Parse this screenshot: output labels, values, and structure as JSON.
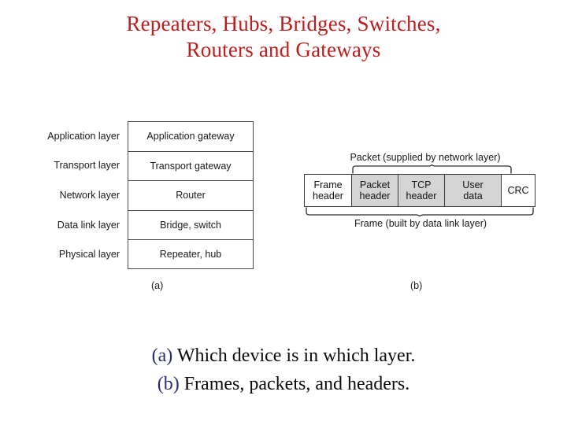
{
  "title": {
    "line1": "Repeaters, Hubs, Bridges, Switches,",
    "line2": "Routers and Gateways",
    "color": "#be1d1d"
  },
  "figure_a": {
    "sub_caption": "(a)",
    "rows": [
      {
        "layer": "Application layer",
        "device": "Application gateway"
      },
      {
        "layer": "Transport layer",
        "device": "Transport gateway"
      },
      {
        "layer": "Network layer",
        "device": "Router"
      },
      {
        "layer": "Data link layer",
        "device": "Bridge, switch"
      },
      {
        "layer": "Physical layer",
        "device": "Repeater, hub"
      }
    ]
  },
  "figure_b": {
    "sub_caption": "(b)",
    "top_label": "Packet (supplied by network layer)",
    "bottom_label": "Frame (built by data link layer)",
    "fill_gray": "#d4d4d4",
    "cells": [
      {
        "line1": "Frame",
        "line2": "header",
        "shaded": false
      },
      {
        "line1": "Packet",
        "line2": "header",
        "shaded": true
      },
      {
        "line1": "TCP",
        "line2": "header",
        "shaded": true
      },
      {
        "line1": "User",
        "line2": "data",
        "shaded": true
      },
      {
        "line1": "CRC",
        "line2": "",
        "shaded": false
      }
    ]
  },
  "captions": {
    "marker_color": "#2b2b72",
    "lines": [
      {
        "marker": "(a)",
        "text": "Which device is in which layer."
      },
      {
        "marker": "(b)",
        "text": "Frames, packets, and headers."
      }
    ]
  }
}
